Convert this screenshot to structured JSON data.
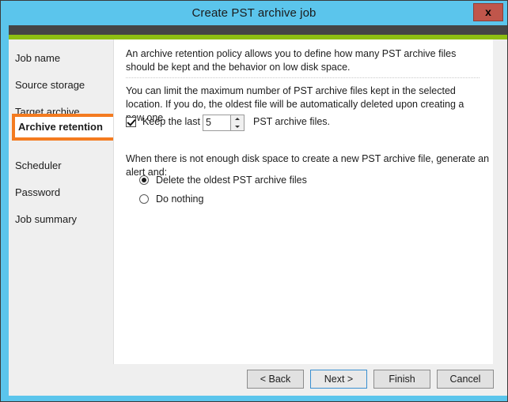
{
  "window": {
    "title": "Create PST archive job",
    "close_label": "x",
    "accent_blue": "#5bc5ec",
    "accent_green": "#8ebf12",
    "accent_dark": "#454545",
    "highlight_orange": "#f47b20"
  },
  "sidebar": {
    "items": [
      {
        "label": "Job name",
        "active": false
      },
      {
        "label": "Source storage",
        "active": false
      },
      {
        "label": "Target archive",
        "active": false
      },
      {
        "label": "Archive retention",
        "active": true
      },
      {
        "label": "Scheduler",
        "active": false
      },
      {
        "label": "Password",
        "active": false
      },
      {
        "label": "Job summary",
        "active": false
      }
    ]
  },
  "content": {
    "intro_paragraph": "An archive retention policy allows you to define how many PST archive files should be kept and the behavior on low disk space.",
    "limit_paragraph": "You can limit the maximum number of PST archive files kept in the selected location. If you do, the oldest file will be automatically deleted upon creating a new one.",
    "keep_checkbox_label": "Keep the last",
    "keep_count_value": "5",
    "keep_suffix_label": "PST archive files.",
    "disk_space_prompt": "When there is not enough disk space to create a new PST archive file, generate an alert and:",
    "radio_options": [
      {
        "label": "Delete the oldest PST archive files",
        "selected": true
      },
      {
        "label": "Do nothing",
        "selected": false
      }
    ]
  },
  "footer": {
    "back_label": "< Back",
    "next_label": "Next >",
    "finish_label": "Finish",
    "cancel_label": "Cancel"
  }
}
